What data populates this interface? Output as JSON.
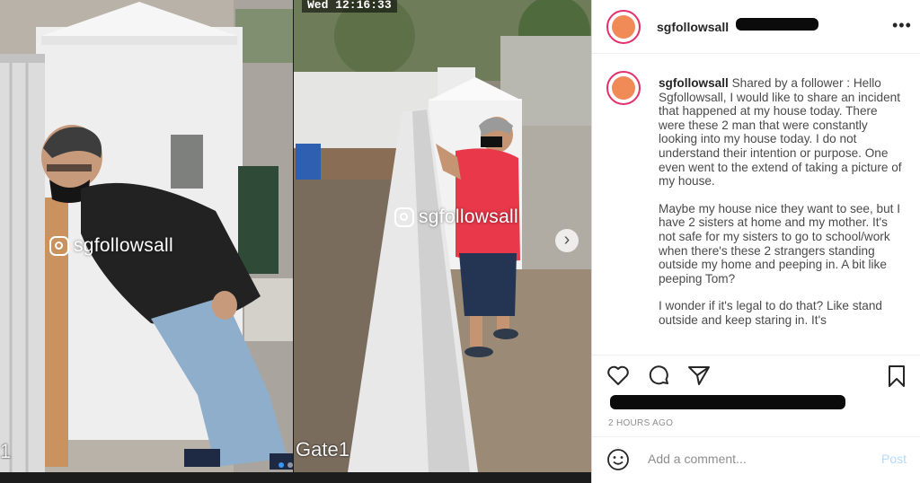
{
  "post": {
    "username": "sgfollowsall",
    "time_ago": "2 HOURS AGO",
    "comment_placeholder": "Add a comment...",
    "post_label": "Post",
    "more_label": "•••"
  },
  "caption": {
    "author": "sgfollowsall",
    "paragraphs": [
      "Shared by a follower : Hello Sgfollowsall, I would like to share an incident that happened at my house today. There were these 2 man that were constantly looking into my house today. I do not understand their intention or purpose. One even went to the extend of taking a picture of my house.",
      "Maybe my house nice they want to see, but I have 2 sisters at home and my mother. It's not safe for my sisters to go to school/work when there's these 2 strangers standing outside my home and peeping in. A bit like peeping Tom?",
      "I wonder if it's legal to do that? Like stand outside and keep staring in. It's"
    ]
  },
  "media": {
    "watermark": "sgfollowsall",
    "timestamp": "Wed 12:16:33",
    "camera_label_left": "1",
    "camera_label_right": "Gate1"
  },
  "icons": {
    "heart": "heart-icon",
    "comment": "comment-icon",
    "share": "share-icon",
    "bookmark": "bookmark-icon",
    "smile": "smile-icon",
    "next": "chevron-right-icon",
    "instagram": "instagram-icon"
  },
  "colors": {
    "accent": "#3897f0",
    "post_button": "#b3dbff",
    "shirt_red": "#e8384a"
  }
}
